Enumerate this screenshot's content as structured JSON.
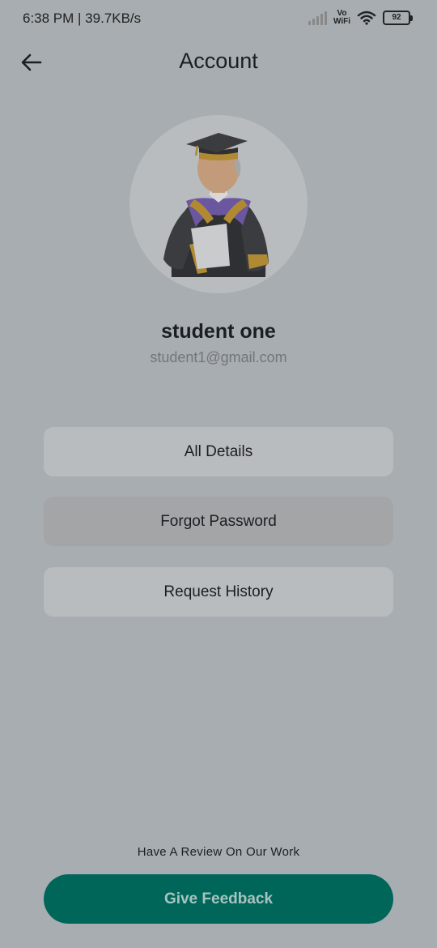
{
  "status_bar": {
    "time_speed": "6:38 PM | 39.7KB/s",
    "vowifi_top": "Vo",
    "vowifi_bottom": "WiFi",
    "battery": "92"
  },
  "header": {
    "title": "Account"
  },
  "profile": {
    "name": "student one",
    "email": "student1@gmail.com"
  },
  "menu": {
    "items": [
      {
        "label": "All Details"
      },
      {
        "label": "Forgot Password"
      },
      {
        "label": "Request History"
      }
    ]
  },
  "footer": {
    "review_prompt": "Have A Review On Our Work",
    "feedback_label": "Give Feedback"
  },
  "colors": {
    "background": "#a8adb1",
    "accent": "#00665a",
    "card": "#b9bcbf"
  },
  "icons": {
    "back": "arrow-left-icon",
    "signal": "signal-icon",
    "wifi": "wifi-icon",
    "battery": "battery-icon"
  }
}
